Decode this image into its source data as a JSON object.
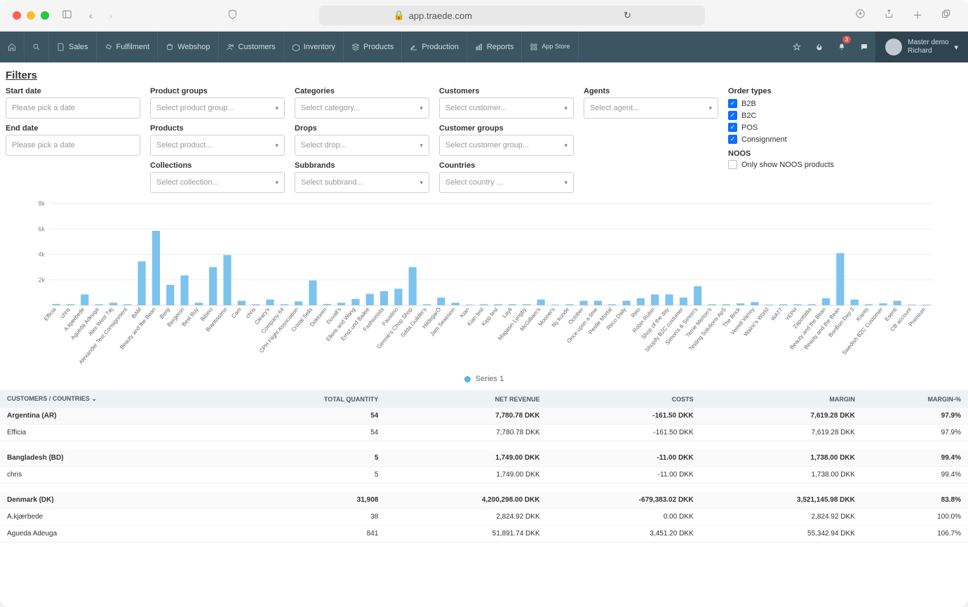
{
  "browser": {
    "url_host": "app.traede.com"
  },
  "nav": {
    "items": [
      "Sales",
      "Fulfilment",
      "Webshop",
      "Customers",
      "Inventory",
      "Products",
      "Production",
      "Reports",
      "App Store"
    ],
    "notification_count": "3",
    "user_line1": "Master demo",
    "user_line2": "Richard"
  },
  "filters": {
    "title": "Filters",
    "start_date_label": "Start date",
    "start_date_placeholder": "Please pick a date",
    "end_date_label": "End date",
    "end_date_placeholder": "Please pick a date",
    "product_groups_label": "Product groups",
    "product_groups_placeholder": "Select product group...",
    "products_label": "Products",
    "products_placeholder": "Select product...",
    "collections_label": "Collections",
    "collections_placeholder": "Select collection...",
    "categories_label": "Categories",
    "categories_placeholder": "Select category...",
    "drops_label": "Drops",
    "drops_placeholder": "Select drop...",
    "subbrands_label": "Subbrands",
    "subbrands_placeholder": "Select subbrand...",
    "customers_label": "Customers",
    "customers_placeholder": "Select customer...",
    "customer_groups_label": "Customer groups",
    "customer_groups_placeholder": "Select customer group...",
    "countries_label": "Countries",
    "countries_placeholder": "Select country ...",
    "agents_label": "Agents",
    "agents_placeholder": "Select agent...",
    "order_types_label": "Order types",
    "order_types": [
      "B2B",
      "B2C",
      "POS",
      "Consignment"
    ],
    "noos_label": "NOOS",
    "noos_checkbox": "Only show NOOS products"
  },
  "chart_data": {
    "type": "bar",
    "title": "",
    "xlabel": "",
    "ylabel": "",
    "ylim": [
      0,
      8000
    ],
    "yticks": [
      "8k",
      "6k",
      "4k",
      "2k"
    ],
    "legend": "Series 1",
    "categories": [
      "Efficia",
      "chris",
      "A.kjærbede",
      "Agueda Adeuga",
      "Alex West Tøj",
      "Alexander Test Consignment",
      "BAM",
      "Beauty and the Bean",
      "Benji",
      "Bergeron",
      "Best Buy",
      "Bibino",
      "Brantissimo",
      "Cam",
      "chris",
      "Cleary's",
      "Company 64",
      "CPH Flight Association",
      "Cristal Sells",
      "Doktoren",
      "Duvall's",
      "Elkins and Wang",
      "Ernst und Bailee",
      "Fashionista",
      "Faustino",
      "Gennie's Chop Shop",
      "Gilda Guilder's",
      "HildegarÖ",
      "Jam Seassion",
      "Kian",
      "Kian test",
      "Kipp test",
      "Layli",
      "Magasin Lyngby",
      "McGilliam's",
      "Moonei's",
      "Ny kunde",
      "October",
      "Once upon a time",
      "Pestle Mortal",
      "Reco Daily",
      "Reis",
      "Robin Rubin",
      "Shop of the day",
      "Shopify B2C customer",
      "Simon's & Simon's",
      "Terrie Merton's",
      "Testing Solutions ApS",
      "The Brick",
      "Verrell Varrey",
      "Wainc's World",
      "WATT",
      "YEPH",
      "Zapottatta",
      "Beauty and the Bean",
      "Beauty and the Bean",
      "BonBon Dep 3",
      "Kiants",
      "Swedish B2C Customer",
      "Esenti",
      "CB account",
      "Premium"
    ],
    "values": [
      100,
      80,
      850,
      80,
      200,
      80,
      3450,
      5850,
      1600,
      2350,
      200,
      3000,
      3950,
      350,
      80,
      450,
      80,
      300,
      1950,
      100,
      200,
      500,
      900,
      1100,
      1300,
      3000,
      80,
      600,
      200,
      50,
      80,
      80,
      80,
      80,
      450,
      50,
      80,
      350,
      350,
      80,
      350,
      550,
      850,
      850,
      600,
      1500,
      80,
      80,
      150,
      250,
      50,
      80,
      80,
      80,
      550,
      4100,
      450,
      80,
      150,
      350,
      50,
      50
    ]
  },
  "table": {
    "headers": [
      "CUSTOMERS / COUNTRIES",
      "TOTAL QUANTITY",
      "NET REVENUE",
      "COSTS",
      "MARGIN",
      "MARGIN-%"
    ],
    "rows": [
      {
        "type": "country",
        "cells": [
          "Argentina (AR)",
          "54",
          "7,780.78 DKK",
          "-161.50 DKK",
          "7,619.28 DKK",
          "97.9%"
        ]
      },
      {
        "type": "customer",
        "cells": [
          "Efficia",
          "54",
          "7,780.78 DKK",
          "-161.50 DKK",
          "7,619.28 DKK",
          "97.9%"
        ]
      },
      {
        "type": "spacer"
      },
      {
        "type": "country",
        "cells": [
          "Bangladesh (BD)",
          "5",
          "1,749.00 DKK",
          "-11.00 DKK",
          "1,738.00 DKK",
          "99.4%"
        ]
      },
      {
        "type": "customer",
        "cells": [
          "chris",
          "5",
          "1,749.00 DKK",
          "-11.00 DKK",
          "1,738.00 DKK",
          "99.4%"
        ]
      },
      {
        "type": "spacer"
      },
      {
        "type": "country",
        "cells": [
          "Denmark (DK)",
          "31,908",
          "4,200,298.00 DKK",
          "-679,383.02 DKK",
          "3,521,145.98 DKK",
          "83.8%"
        ]
      },
      {
        "type": "customer",
        "cells": [
          "A.kjærbede",
          "38",
          "2,824.92 DKK",
          "0.00 DKK",
          "2,824.92 DKK",
          "100.0%"
        ]
      },
      {
        "type": "customer",
        "cells": [
          "Agueda Adeuga",
          "841",
          "51,891.74 DKK",
          "3,451.20 DKK",
          "55,342.94 DKK",
          "106.7%"
        ]
      }
    ]
  }
}
